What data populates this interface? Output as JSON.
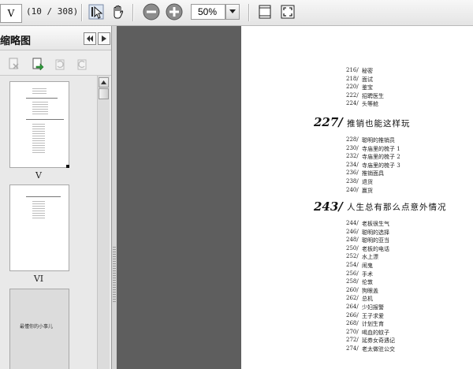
{
  "toolbar": {
    "page_input_value": "V",
    "page_count_text": "(10 / 308)",
    "zoom_value": "50%",
    "icons": [
      "select-tool-icon",
      "hand-tool-icon",
      "zoom-out-icon",
      "zoom-in-icon",
      "fit-page-icon",
      "fit-window-icon"
    ]
  },
  "sidebar": {
    "title": "缩略图",
    "thumbnails": [
      {
        "label": "V",
        "caption": ""
      },
      {
        "label": "VI",
        "caption": ""
      },
      {
        "label": "",
        "caption": "最懂你的小事儿"
      }
    ]
  },
  "document": {
    "top_entries": [
      {
        "num": "216/",
        "text": "秘密"
      },
      {
        "num": "218/",
        "text": "面试"
      },
      {
        "num": "220/",
        "text": "鉴宝"
      },
      {
        "num": "222/",
        "text": "招聘医生"
      },
      {
        "num": "224/",
        "text": "头等舱"
      }
    ],
    "chapter1": {
      "num": "227/",
      "title": "推销也能这样玩",
      "entries": [
        {
          "num": "228/",
          "text": "聪明的推销员"
        },
        {
          "num": "230/",
          "text": "寺庙里的梳子 1"
        },
        {
          "num": "232/",
          "text": "寺庙里的梳子 2"
        },
        {
          "num": "234/",
          "text": "寺庙里的梳子 3"
        },
        {
          "num": "236/",
          "text": "推销面具"
        },
        {
          "num": "238/",
          "text": "退货"
        },
        {
          "num": "240/",
          "text": "赢货"
        }
      ]
    },
    "chapter2": {
      "num": "243/",
      "title": "人生总有那么点意外情况",
      "entries": [
        {
          "num": "244/",
          "text": "老板很生气"
        },
        {
          "num": "246/",
          "text": "聪明的选择"
        },
        {
          "num": "248/",
          "text": "聪明的亚当"
        },
        {
          "num": "250/",
          "text": "老板的电话"
        },
        {
          "num": "252/",
          "text": "水上漂"
        },
        {
          "num": "254/",
          "text": "闹鬼"
        },
        {
          "num": "256/",
          "text": "手术"
        },
        {
          "num": "258/",
          "text": "伦敦"
        },
        {
          "num": "260/",
          "text": "狗眼盖"
        },
        {
          "num": "262/",
          "text": "总机"
        },
        {
          "num": "264/",
          "text": "少妇报警"
        },
        {
          "num": "266/",
          "text": "王子求爱"
        },
        {
          "num": "268/",
          "text": "计划生育"
        },
        {
          "num": "270/",
          "text": "喝血的蚊子"
        },
        {
          "num": "272/",
          "text": "延券女奇遇记"
        },
        {
          "num": "274/",
          "text": "老太做驻公交"
        }
      ]
    }
  },
  "colors": {
    "canvas_bg": "#5e5e5e",
    "toolbar_bg": "#ececec",
    "page_bg": "#ffffff"
  }
}
